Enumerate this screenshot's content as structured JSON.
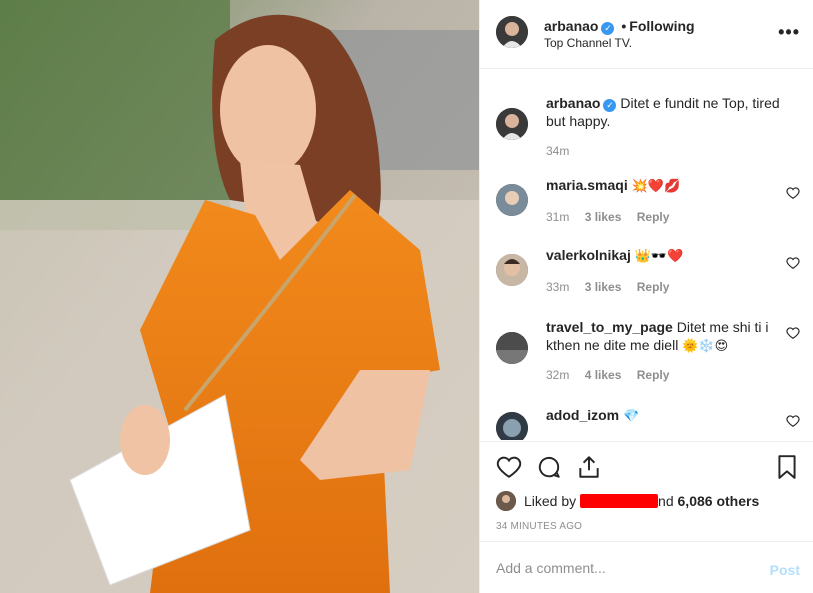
{
  "post": {
    "author": "arbanao",
    "separator": "•",
    "follow_label": "Following",
    "location": "Top Channel TV."
  },
  "caption": {
    "author": "arbanao",
    "text": "Ditet e fundit ne Top, tired but happy.",
    "time": "34m"
  },
  "comments": [
    {
      "user": "maria.smaqi",
      "text": "",
      "emojis": "💥❤️💋",
      "time": "31m",
      "likes": "3 likes",
      "reply": "Reply"
    },
    {
      "user": "valerkolnikaj",
      "text": "",
      "emojis": "👑🕶️❤️",
      "time": "33m",
      "likes": "3 likes",
      "reply": "Reply"
    },
    {
      "user": "travel_to_my_page",
      "text": "Ditet me shi ti i kthen ne dite me diell",
      "emojis": "🌞❄️😍",
      "time": "32m",
      "likes": "4 likes",
      "reply": "Reply"
    },
    {
      "user": "adod_izom",
      "text": "",
      "emojis": "💎",
      "time": "",
      "likes": "",
      "reply": ""
    }
  ],
  "likes": {
    "prefix": "Liked by",
    "suffix": "nd",
    "count": "6,086 others"
  },
  "time_ago": "34 MINUTES AGO",
  "add_comment": {
    "placeholder": "Add a comment...",
    "post_label": "Post"
  },
  "colors": {
    "link_blue": "#3897f0",
    "post_disabled": "#b2dffc",
    "muted": "#8e8e8e",
    "redaction": "#ff0000"
  },
  "icons": [
    "verified-badge-icon",
    "more-options-icon",
    "heart-icon",
    "comment-icon",
    "share-icon",
    "bookmark-icon"
  ]
}
